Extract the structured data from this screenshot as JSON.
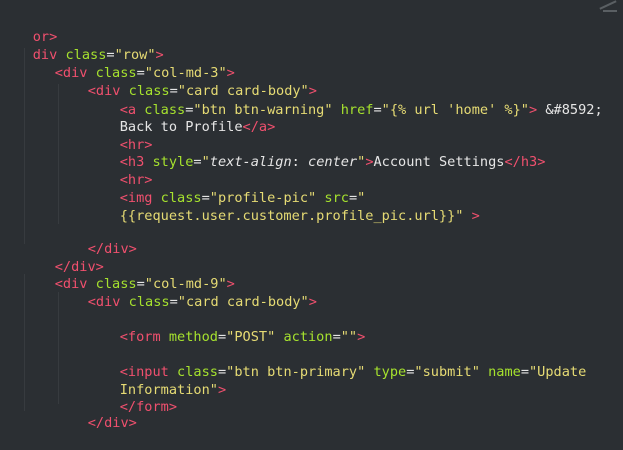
{
  "colors": {
    "background": "#2b2f33",
    "tag": "#f0506e",
    "attribute": "#a6e22e",
    "string": "#e6db74",
    "text": "#e6e6e6"
  },
  "code": {
    "l1": {
      "a": "or>"
    },
    "l2": {
      "a": "div",
      "b": " class",
      "c": "=",
      "d": "\"row\"",
      "e": ">"
    },
    "l3": {
      "a": "<div",
      "b": " class",
      "c": "=",
      "d": "\"col-md-3\"",
      "e": ">"
    },
    "l4": {
      "a": "<div",
      "b": " class",
      "c": "=",
      "d": "\"card card-body\"",
      "e": ">"
    },
    "l5": {
      "a": "<a",
      "b": " class",
      "c": "=",
      "d": "\"btn btn-warning\"",
      "e": " href",
      "f": "=",
      "g": "\"{% url 'home' %}\"",
      "h": ">",
      "i": " &#8592;"
    },
    "l6": {
      "a": "Back to Profile",
      "b": "</a>"
    },
    "l7": {
      "a": "<hr>"
    },
    "l8": {
      "a": "<h3",
      "b": " style",
      "c": "=",
      "d": "\"",
      "e": "text-align",
      "f": ": ",
      "g": "center",
      "h": "\"",
      "i": ">",
      "j": "Account Settings",
      "k": "</h3>"
    },
    "l9": {
      "a": "<hr>"
    },
    "l10": {
      "a": "<img",
      "b": " class",
      "c": "=",
      "d": "\"profile-pic\"",
      "e": " src",
      "f": "=",
      "g": "\""
    },
    "l11": {
      "a": "{{request.user.customer.profile_pic.url}}\"",
      "b": " >"
    },
    "l12": {
      "a": "</div>"
    },
    "l13": {
      "a": "</div>"
    },
    "l14": {
      "a": "<div",
      "b": " class",
      "c": "=",
      "d": "\"col-md-9\"",
      "e": ">"
    },
    "l15": {
      "a": "<div",
      "b": " class",
      "c": "=",
      "d": "\"card card-body\"",
      "e": ">"
    },
    "l16": {
      "a": "<form",
      "b": " method",
      "c": "=",
      "d": "\"POST\"",
      "e": " action",
      "f": "=",
      "g": "\"\"",
      "h": ">"
    },
    "l17": {
      "a": "<input",
      "b": " class",
      "c": "=",
      "d": "\"btn btn-primary\"",
      "e": " type",
      "f": "=",
      "g": "\"submit\"",
      "h": " name",
      "i": "=",
      "j": "\"Update"
    },
    "l18": {
      "a": "Information\"",
      "b": ">"
    },
    "l19": {
      "a": "</form>"
    },
    "l20": {
      "a": "</div>"
    }
  }
}
